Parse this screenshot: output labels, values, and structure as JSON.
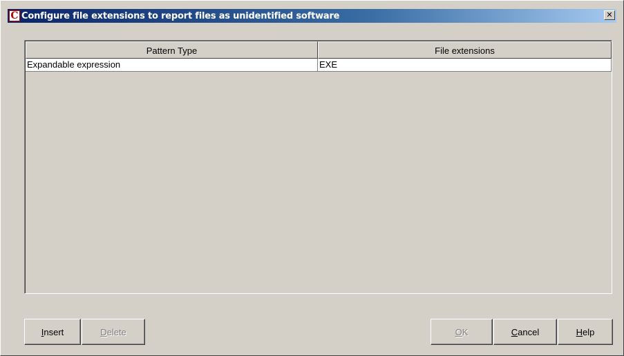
{
  "window": {
    "title": "Configure file extensions to report files as unidentified software",
    "app_icon_letter": "C",
    "close_glyph": "✕"
  },
  "table": {
    "columns": [
      "Pattern Type",
      "File extensions"
    ],
    "rows": [
      [
        "Expandable expression",
        "EXE"
      ]
    ]
  },
  "buttons": {
    "insert": {
      "mnemonic": "I",
      "rest": "nsert",
      "enabled": true
    },
    "delete": {
      "mnemonic": "D",
      "rest": "elete",
      "enabled": false
    },
    "ok": {
      "mnemonic": "O",
      "rest": "K",
      "enabled": false
    },
    "cancel": {
      "mnemonic": "C",
      "rest": "ancel",
      "enabled": true
    },
    "help": {
      "mnemonic": "H",
      "rest": "elp",
      "enabled": true
    }
  },
  "colors": {
    "title_gradient_start": "#0a246a",
    "title_gradient_end": "#a6caf0",
    "face": "#d4d0c8",
    "icon_red": "#c00000"
  }
}
